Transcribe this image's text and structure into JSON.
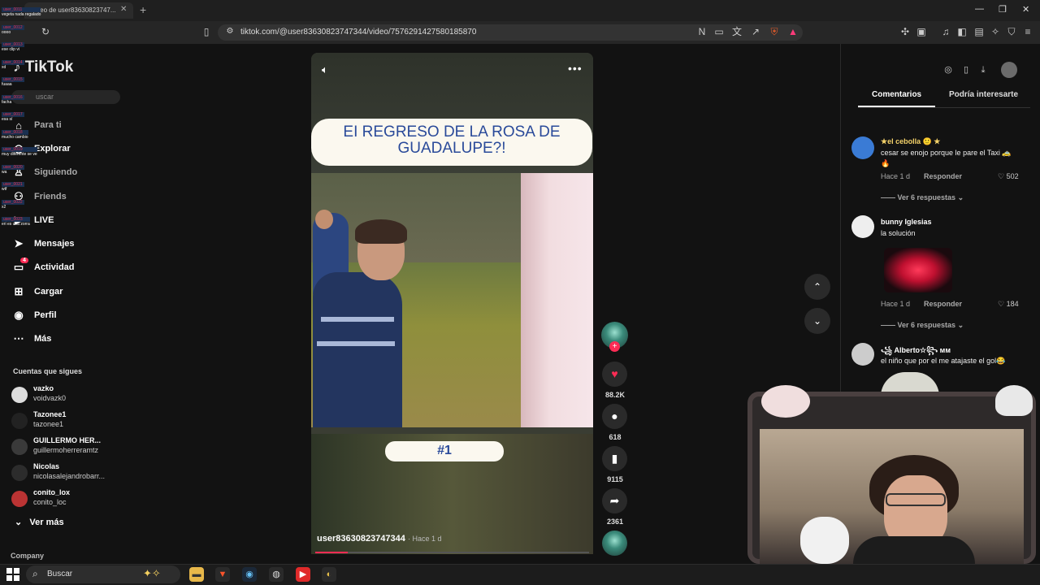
{
  "browser": {
    "tab_title": "...deo de user83630823747...",
    "url": "tiktok.com/@user83630823747344/video/7576291427580185870"
  },
  "sidebar": {
    "logo": "TikTok",
    "search_placeholder": "uscar",
    "nav": [
      {
        "label": "Para ti",
        "icon": "home-icon"
      },
      {
        "label": "Explorar",
        "icon": "compass-icon"
      },
      {
        "label": "Siguiendo",
        "icon": "following-icon"
      },
      {
        "label": "Friends",
        "icon": "friends-icon"
      },
      {
        "label": "LIVE",
        "icon": "live-icon"
      },
      {
        "label": "Mensajes",
        "icon": "send-icon"
      },
      {
        "label": "Actividad",
        "icon": "inbox-icon",
        "badge": "4"
      },
      {
        "label": "Cargar",
        "icon": "upload-icon"
      },
      {
        "label": "Perfil",
        "icon": "avatar-icon"
      },
      {
        "label": "Más",
        "icon": "more-icon"
      }
    ],
    "following_title": "Cuentas que sigues",
    "accounts": [
      {
        "name": "vazko",
        "handle": "voidvazk0"
      },
      {
        "name": "Tazonee1",
        "handle": "tazonee1"
      },
      {
        "name": "GUILLERMO HER...",
        "handle": "guillermoherreramtz"
      },
      {
        "name": "Nicolas",
        "handle": "nicolasalejandrobarr..."
      },
      {
        "name": "conito_lox",
        "handle": "conito_loc"
      }
    ],
    "see_more": "Ver más",
    "company": "Company"
  },
  "chat": [
    {
      "user": "user_0011",
      "msg": "vegeta nada regalado"
    },
    {
      "user": "user_0012",
      "msg": "oooo"
    },
    {
      "user": "user_0013",
      "msg": "ese clip vi"
    },
    {
      "user": "user_0014",
      "msg": "xd"
    },
    {
      "user": "user_0015",
      "msg": "fuaaa"
    },
    {
      "user": "user_0016",
      "msg": "fachа"
    },
    {
      "user": "user_0017",
      "msg": "esa sí"
    },
    {
      "user": "user_0018",
      "msg": "mucho cambio"
    },
    {
      "user": "user_0019",
      "msg": "muy diferente se ve"
    },
    {
      "user": "user_0020",
      "msg": "wa"
    },
    {
      "user": "user_0021",
      "msg": "wtf"
    },
    {
      "user": "user_0022",
      "msg": "x2"
    },
    {
      "user": "user_0023",
      "msg": "eri es una zorra"
    }
  ],
  "video": {
    "title_line1": "EI REGRESO DE LA ROSA DE",
    "title_line2": "GUADALUPE?!",
    "number_label": "#1",
    "author": "user83630823747344",
    "time": "· Hace 1 d",
    "progress_fraction": 0.12
  },
  "actions": {
    "likes": "88.2K",
    "comments": "618",
    "saves": "9115",
    "shares": "2361"
  },
  "panel": {
    "tab_comments": "Comentarios",
    "tab_interest": "Podría interesarte",
    "comments": [
      {
        "name": "★el cebolla 🙂 ★",
        "text": "cesar se enojo porque le pare el Taxi 🚕",
        "text2": "🔥",
        "time": "Hace 1 d",
        "reply": "Responder",
        "likes": "502",
        "more": "Ver 6 respuestas"
      },
      {
        "name": "bunny Iglesias",
        "text": "la solución",
        "time": "Hace 1 d",
        "reply": "Responder",
        "likes": "184",
        "more": "Ver 6 respuestas"
      },
      {
        "name": "꧁ Alberto☆꧂ ᴍᴍ",
        "text": "el niño que por el me atajaste el gol😂"
      }
    ]
  },
  "taskbar": {
    "search_placeholder": "Buscar"
  },
  "colors": {
    "accent": "#fe2c55",
    "title_blue": "#2a4a9a"
  }
}
